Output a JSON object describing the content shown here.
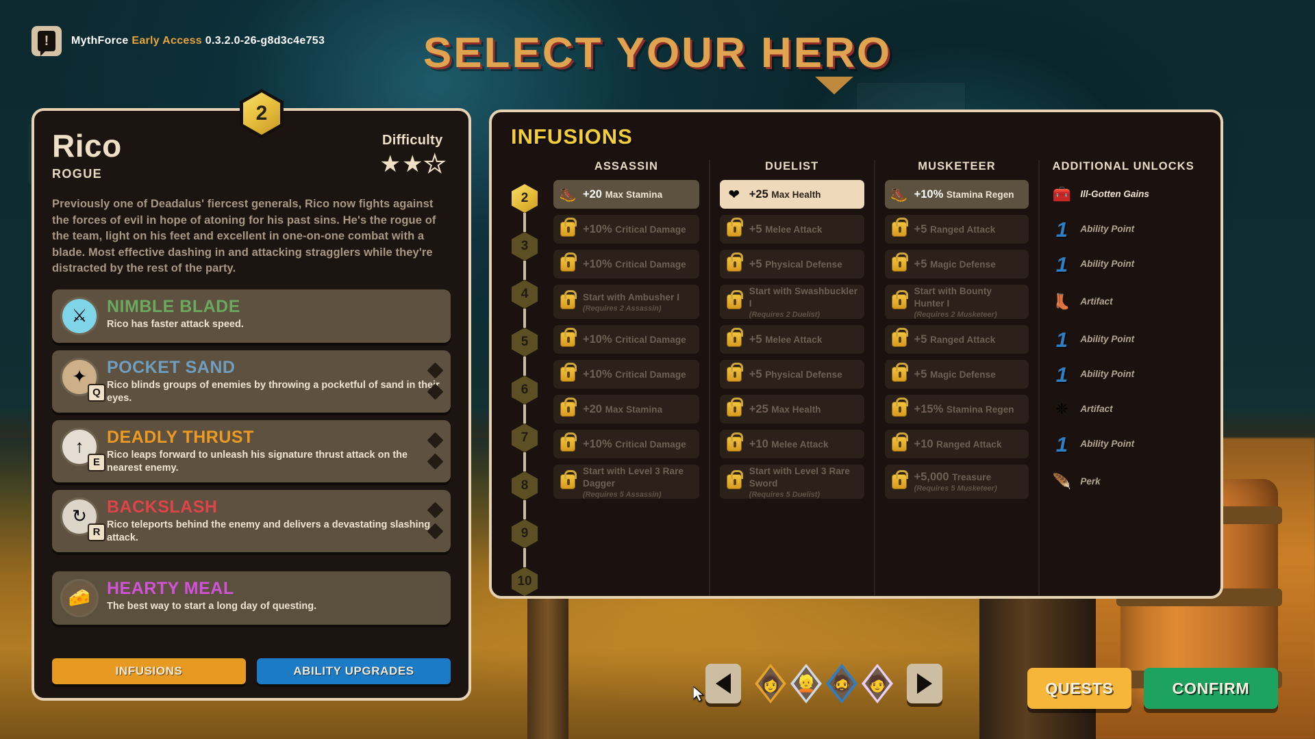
{
  "version_bar": {
    "icon": "speech-bubble-exclaim-icon",
    "game": "MythForce",
    "channel": "Early Access",
    "build": "0.3.2.0-26-g8d3c4e753"
  },
  "screen": {
    "title": "SELECT YOUR HERO"
  },
  "hero": {
    "level": "2",
    "name": "Rico",
    "class": "ROGUE",
    "difficulty_label": "Difficulty",
    "difficulty_filled": 2,
    "difficulty_total": 3,
    "description": "Previously one of Deadalus' fiercest generals, Rico now fights against the forces of evil in hope of atoning for his past sins. He's the rogue of the team, light on his feet and excellent in one-on-one combat with a blade. Most effective dashing in and attacking stragglers while they're distracted by the rest of the party.",
    "abilities": [
      {
        "name": "NIMBLE BLADE",
        "color": "#6aa95e",
        "desc": "Rico has faster attack speed.",
        "icon": "dagger-slash-icon",
        "glyph": "⚔",
        "icon_bg": "#7fd4e8",
        "key": null,
        "upgrade_dots": 0
      },
      {
        "name": "POCKET SAND",
        "color": "#6f9ec0",
        "desc": "Rico blinds groups of enemies by throwing a pocketful of sand in their eyes.",
        "icon": "pocket-sand-icon",
        "glyph": "✦",
        "icon_bg": "#cdb08a",
        "key": "Q",
        "upgrade_dots": 2
      },
      {
        "name": "DEADLY THRUST",
        "color": "#ec9a22",
        "desc": "Rico leaps forward to unleash his signature thrust attack on the nearest enemy.",
        "icon": "deadly-thrust-icon",
        "glyph": "↑",
        "icon_bg": "#e5ddd2",
        "key": "E",
        "upgrade_dots": 2
      },
      {
        "name": "BACKSLASH",
        "color": "#e0434a",
        "desc": "Rico teleports behind the enemy and delivers a devastating slashing attack.",
        "icon": "backslash-icon",
        "glyph": "↻",
        "icon_bg": "#ded5c9",
        "key": "R",
        "upgrade_dots": 2
      }
    ],
    "perk": {
      "name": "HEARTY MEAL",
      "color": "#d252d8",
      "desc": "The best way to start a long day of questing.",
      "icon": "cheese-meal-icon",
      "glyph": "🧀",
      "icon_bg": "#6d5a44"
    },
    "buttons": {
      "infusions": "INFUSIONS",
      "ability_upgrades": "ABILITY UPGRADES"
    }
  },
  "infusions": {
    "title": "INFUSIONS",
    "columns": [
      "ASSASSIN",
      "DUELIST",
      "MUSKETEER",
      "ADDITIONAL UNLOCKS"
    ],
    "levels": [
      "2",
      "3",
      "4",
      "5",
      "6",
      "7",
      "8",
      "9",
      "10"
    ],
    "current_level": "2",
    "assassin": [
      {
        "state": "unlocked",
        "icon": "boot-icon",
        "glyph": "🥾",
        "amount": "+20",
        "label": "Max Stamina",
        "sub": null
      },
      {
        "state": "locked",
        "icon": "lock-icon",
        "amount": "+10%",
        "label": "Critical Damage",
        "sub": null
      },
      {
        "state": "locked",
        "icon": "lock-icon",
        "amount": "+10%",
        "label": "Critical Damage",
        "sub": null
      },
      {
        "state": "locked",
        "icon": "lock-icon",
        "amount": "",
        "label": "Start with Ambusher I",
        "sub": "(Requires 2 Assassin)"
      },
      {
        "state": "locked",
        "icon": "lock-icon",
        "amount": "+10%",
        "label": "Critical Damage",
        "sub": null
      },
      {
        "state": "locked",
        "icon": "lock-icon",
        "amount": "+10%",
        "label": "Critical Damage",
        "sub": null
      },
      {
        "state": "locked",
        "icon": "lock-icon",
        "amount": "+20",
        "label": "Max Stamina",
        "sub": null
      },
      {
        "state": "locked",
        "icon": "lock-icon",
        "amount": "+10%",
        "label": "Critical Damage",
        "sub": null
      },
      {
        "state": "locked",
        "icon": "lock-icon",
        "amount": "",
        "label": "Start with Level 3 Rare Dagger",
        "sub": "(Requires 5 Assassin)"
      }
    ],
    "duelist": [
      {
        "state": "selected",
        "icon": "heart-icon",
        "glyph": "❤",
        "amount": "+25",
        "label": "Max Health",
        "sub": null
      },
      {
        "state": "locked",
        "icon": "lock-icon",
        "amount": "+5",
        "label": "Melee Attack",
        "sub": null
      },
      {
        "state": "locked",
        "icon": "lock-icon",
        "amount": "+5",
        "label": "Physical Defense",
        "sub": null
      },
      {
        "state": "locked",
        "icon": "lock-icon",
        "amount": "",
        "label": "Start with Swashbuckler I",
        "sub": "(Requires 2 Duelist)"
      },
      {
        "state": "locked",
        "icon": "lock-icon",
        "amount": "+5",
        "label": "Melee Attack",
        "sub": null
      },
      {
        "state": "locked",
        "icon": "lock-icon",
        "amount": "+5",
        "label": "Physical Defense",
        "sub": null
      },
      {
        "state": "locked",
        "icon": "lock-icon",
        "amount": "+25",
        "label": "Max Health",
        "sub": null
      },
      {
        "state": "locked",
        "icon": "lock-icon",
        "amount": "+10",
        "label": "Melee Attack",
        "sub": null
      },
      {
        "state": "locked",
        "icon": "lock-icon",
        "amount": "",
        "label": "Start with Level 3 Rare Sword",
        "sub": "(Requires 5 Duelist)"
      }
    ],
    "musketeer": [
      {
        "state": "unlocked",
        "icon": "boot-icon",
        "glyph": "🥾",
        "amount": "+10%",
        "label": "Stamina Regen",
        "sub": null
      },
      {
        "state": "locked",
        "icon": "lock-icon",
        "amount": "+5",
        "label": "Ranged Attack",
        "sub": null
      },
      {
        "state": "locked",
        "icon": "lock-icon",
        "amount": "+5",
        "label": "Magic Defense",
        "sub": null
      },
      {
        "state": "locked",
        "icon": "lock-icon",
        "amount": "",
        "label": "Start with Bounty Hunter I",
        "sub": "(Requires 2 Musketeer)"
      },
      {
        "state": "locked",
        "icon": "lock-icon",
        "amount": "+5",
        "label": "Ranged Attack",
        "sub": null
      },
      {
        "state": "locked",
        "icon": "lock-icon",
        "amount": "+5",
        "label": "Magic Defense",
        "sub": null
      },
      {
        "state": "locked",
        "icon": "lock-icon",
        "amount": "+15%",
        "label": "Stamina Regen",
        "sub": null
      },
      {
        "state": "locked",
        "icon": "lock-icon",
        "amount": "+10",
        "label": "Ranged Attack",
        "sub": null
      },
      {
        "state": "locked",
        "icon": "lock-icon",
        "amount": "+5,000",
        "label": "Treasure",
        "sub": "(Requires 5 Musketeer)"
      }
    ],
    "additional_unlocks": [
      {
        "icon": "treasure-chest-icon",
        "glyph": "🧰",
        "num": null,
        "label": "Ill-Gotten Gains",
        "bright": true
      },
      {
        "icon": "ability-point-icon",
        "glyph": null,
        "num": "1",
        "label": "Ability Point",
        "bright": false
      },
      {
        "icon": "ability-point-icon",
        "glyph": null,
        "num": "1",
        "label": "Ability Point",
        "bright": false
      },
      {
        "icon": "artifact-boots-icon",
        "glyph": "👢",
        "num": null,
        "label": "Artifact",
        "bright": false
      },
      {
        "icon": "ability-point-icon",
        "glyph": null,
        "num": "1",
        "label": "Ability Point",
        "bright": false
      },
      {
        "icon": "ability-point-icon",
        "glyph": null,
        "num": "1",
        "label": "Ability Point",
        "bright": false
      },
      {
        "icon": "artifact-shards-icon",
        "glyph": "❈",
        "num": null,
        "label": "Artifact",
        "bright": false
      },
      {
        "icon": "ability-point-icon",
        "glyph": null,
        "num": "1",
        "label": "Ability Point",
        "bright": false
      },
      {
        "icon": "perk-wing-icon",
        "glyph": "🪶",
        "num": null,
        "label": "Perk",
        "bright": false
      }
    ]
  },
  "bottom_nav": {
    "prev_icon": "arrow-left-icon",
    "next_icon": "arrow-right-icon",
    "heroes": [
      {
        "name": "hero-1",
        "accent": "#e5a22c",
        "glyph": "👩",
        "selected": false
      },
      {
        "name": "hero-2",
        "accent": "#cfd8e4",
        "glyph": "👱",
        "selected": false
      },
      {
        "name": "hero-3",
        "accent": "#2f7fc4",
        "glyph": "🧔",
        "selected": false
      },
      {
        "name": "hero-4-rico",
        "accent": "#e9d0f0",
        "glyph": "🧑",
        "selected": true
      }
    ]
  },
  "actions": {
    "quests": "QUESTS",
    "confirm": "CONFIRM"
  }
}
